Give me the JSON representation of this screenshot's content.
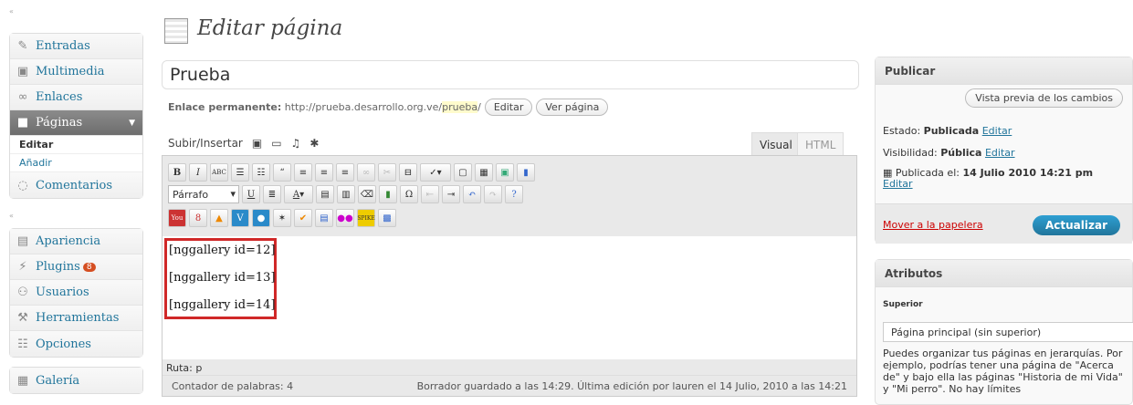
{
  "sidebar": {
    "items": [
      {
        "label": "Entradas",
        "icon": "pin-icon"
      },
      {
        "label": "Multimedia",
        "icon": "media-icon"
      },
      {
        "label": "Enlaces",
        "icon": "links-icon"
      },
      {
        "label": "Páginas",
        "icon": "pages-icon"
      },
      {
        "label": "Comentarios",
        "icon": "comments-icon"
      },
      {
        "label": "Apariencia",
        "icon": "appearance-icon"
      },
      {
        "label": "Plugins",
        "icon": "plugins-icon",
        "badge": "8"
      },
      {
        "label": "Usuarios",
        "icon": "users-icon"
      },
      {
        "label": "Herramientas",
        "icon": "tools-icon"
      },
      {
        "label": "Opciones",
        "icon": "settings-icon"
      },
      {
        "label": "Galería",
        "icon": "gallery-icon"
      }
    ],
    "sub": {
      "editar": "Editar",
      "anadir": "Añadir"
    }
  },
  "page": {
    "title": "Editar página"
  },
  "post": {
    "title": "Prueba"
  },
  "permalink": {
    "label": "Enlace permanente:",
    "url": "http://prueba.desarrollo.org.ve/",
    "slug": "prueba",
    "suffix": "/",
    "edit": "Editar",
    "view": "Ver página"
  },
  "editor": {
    "upload_label": "Subir/Insertar",
    "tab_visual": "Visual",
    "tab_html": "HTML",
    "format": "Párrafo",
    "lines": [
      "[nggallery id=12]",
      "[nggallery id=13]",
      "[nggallery id=14]"
    ],
    "path": "Ruta: p",
    "wordcount": "Contador de palabras: 4",
    "draft_status": "Borrador guardado a las 14:29. Última edición por lauren el 14 Julio, 2010 a las 14:21"
  },
  "publish": {
    "title": "Publicar",
    "preview": "Vista previa de los cambios",
    "status_label": "Estado:",
    "status_value": "Publicada",
    "visibility_label": "Visibilidad:",
    "visibility_value": "Pública",
    "published_label": "Publicada el:",
    "published_value": "14 Julio 2010 14:21 pm",
    "edit": "Editar",
    "trash": "Mover a la papelera",
    "update": "Actualizar"
  },
  "attributes": {
    "title": "Atributos",
    "parent_label": "Superior",
    "parent_value": "Página principal (sin superior)",
    "help": "Puedes organizar tus páginas en jerarquías. Por ejemplo, podrías tener una página de \"Acerca de\" y bajo ella las páginas \"Historia de mi Vida\" y \"Mi perro\". No hay límites"
  }
}
